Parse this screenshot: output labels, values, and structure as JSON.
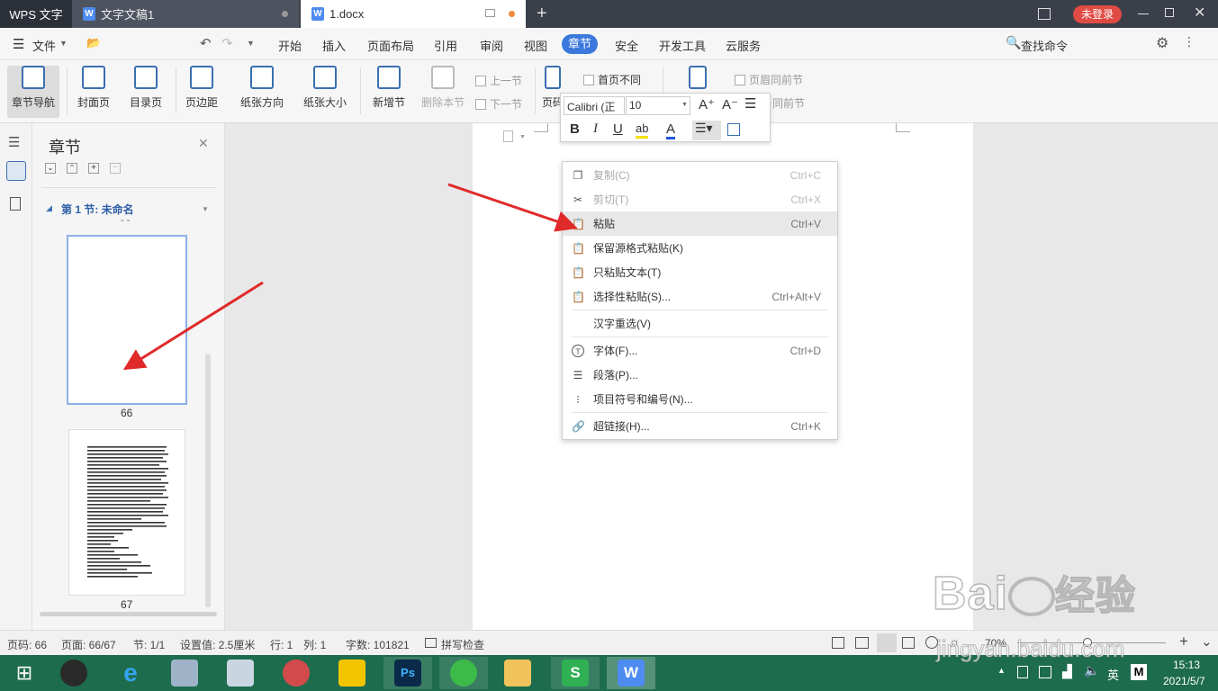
{
  "titlebar": {
    "app": "WPS 文字",
    "tab1": "文字文稿1",
    "tab2": "1.docx",
    "login": "未登录"
  },
  "menu": {
    "file": "文件",
    "items": [
      "开始",
      "插入",
      "页面布局",
      "引用",
      "审阅",
      "视图",
      "章节",
      "安全",
      "开发工具",
      "云服务"
    ],
    "search": "查找命令"
  },
  "ribbon": {
    "nav": "章节导航",
    "cover": "封面页",
    "toc": "目录页",
    "margin": "页边距",
    "orient": "纸张方向",
    "size": "纸张大小",
    "newsec": "新增节",
    "delsec": "删除本节",
    "prev": "上一节",
    "next": "下一节",
    "pagenum": "页码",
    "firstpage": "首页不同",
    "samehead": "页眉同前节",
    "samefoot": "同前节"
  },
  "minitoolbar": {
    "font": "Calibri (正",
    "size": "10"
  },
  "navpanel": {
    "title": "章节",
    "section": "第 1 节: 未命名",
    "dashes": "- -",
    "page1": "66",
    "page2": "67"
  },
  "context_menu": [
    {
      "label": "复制(C)",
      "shortcut": "Ctrl+C",
      "disabled": true
    },
    {
      "label": "剪切(T)",
      "shortcut": "Ctrl+X",
      "disabled": true
    },
    {
      "label": "粘贴",
      "shortcut": "Ctrl+V",
      "highlight": true
    },
    {
      "label": "保留源格式粘贴(K)",
      "shortcut": ""
    },
    {
      "label": "只粘贴文本(T)",
      "shortcut": ""
    },
    {
      "label": "选择性粘贴(S)...",
      "shortcut": "Ctrl+Alt+V"
    },
    {
      "label": "汉字重选(V)",
      "shortcut": ""
    },
    {
      "label": "字体(F)...",
      "shortcut": "Ctrl+D"
    },
    {
      "label": "段落(P)...",
      "shortcut": ""
    },
    {
      "label": "项目符号和编号(N)...",
      "shortcut": ""
    },
    {
      "label": "超链接(H)...",
      "shortcut": "Ctrl+K"
    }
  ],
  "status": {
    "page": "页码: 66",
    "pages": "页面: 66/67",
    "section": "节: 1/1",
    "setting": "设置值: 2.5厘米",
    "row": "行: 1",
    "col": "列: 1",
    "words": "字数: 101821",
    "spell": "拼写检查",
    "zoom": "70%"
  },
  "taskbar": {
    "time": "15:13",
    "date": "2021/5/7",
    "ime": "英"
  },
  "watermark": {
    "text1": "Bai",
    "text2": "经验",
    "url": "jingyan.baidu.com"
  },
  "colors": {
    "accent": "#3a78dc",
    "titlebar": "#3a3f4a",
    "taskbar": "#1e6c4e",
    "arrow": "#e02a2a",
    "login": "#e04b44"
  }
}
